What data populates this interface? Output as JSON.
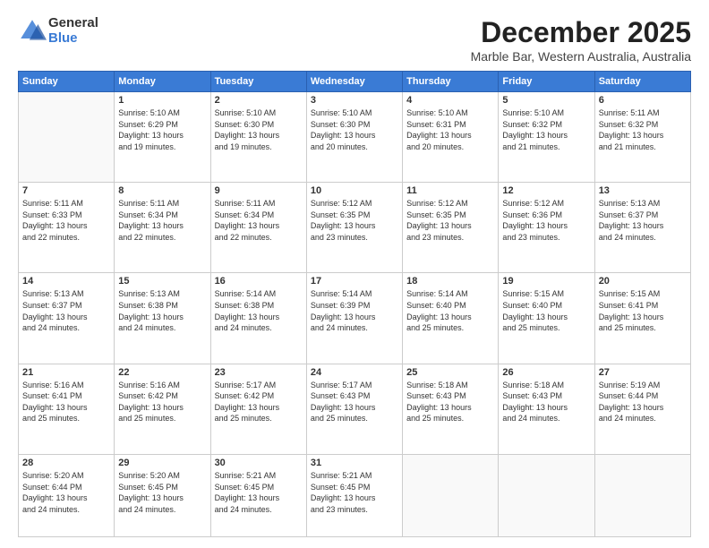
{
  "logo": {
    "general": "General",
    "blue": "Blue"
  },
  "title": "December 2025",
  "subtitle": "Marble Bar, Western Australia, Australia",
  "days_of_week": [
    "Sunday",
    "Monday",
    "Tuesday",
    "Wednesday",
    "Thursday",
    "Friday",
    "Saturday"
  ],
  "weeks": [
    [
      {
        "day": "",
        "info": ""
      },
      {
        "day": "1",
        "info": "Sunrise: 5:10 AM\nSunset: 6:29 PM\nDaylight: 13 hours\nand 19 minutes."
      },
      {
        "day": "2",
        "info": "Sunrise: 5:10 AM\nSunset: 6:30 PM\nDaylight: 13 hours\nand 19 minutes."
      },
      {
        "day": "3",
        "info": "Sunrise: 5:10 AM\nSunset: 6:30 PM\nDaylight: 13 hours\nand 20 minutes."
      },
      {
        "day": "4",
        "info": "Sunrise: 5:10 AM\nSunset: 6:31 PM\nDaylight: 13 hours\nand 20 minutes."
      },
      {
        "day": "5",
        "info": "Sunrise: 5:10 AM\nSunset: 6:32 PM\nDaylight: 13 hours\nand 21 minutes."
      },
      {
        "day": "6",
        "info": "Sunrise: 5:11 AM\nSunset: 6:32 PM\nDaylight: 13 hours\nand 21 minutes."
      }
    ],
    [
      {
        "day": "7",
        "info": "Sunrise: 5:11 AM\nSunset: 6:33 PM\nDaylight: 13 hours\nand 22 minutes."
      },
      {
        "day": "8",
        "info": "Sunrise: 5:11 AM\nSunset: 6:34 PM\nDaylight: 13 hours\nand 22 minutes."
      },
      {
        "day": "9",
        "info": "Sunrise: 5:11 AM\nSunset: 6:34 PM\nDaylight: 13 hours\nand 22 minutes."
      },
      {
        "day": "10",
        "info": "Sunrise: 5:12 AM\nSunset: 6:35 PM\nDaylight: 13 hours\nand 23 minutes."
      },
      {
        "day": "11",
        "info": "Sunrise: 5:12 AM\nSunset: 6:35 PM\nDaylight: 13 hours\nand 23 minutes."
      },
      {
        "day": "12",
        "info": "Sunrise: 5:12 AM\nSunset: 6:36 PM\nDaylight: 13 hours\nand 23 minutes."
      },
      {
        "day": "13",
        "info": "Sunrise: 5:13 AM\nSunset: 6:37 PM\nDaylight: 13 hours\nand 24 minutes."
      }
    ],
    [
      {
        "day": "14",
        "info": "Sunrise: 5:13 AM\nSunset: 6:37 PM\nDaylight: 13 hours\nand 24 minutes."
      },
      {
        "day": "15",
        "info": "Sunrise: 5:13 AM\nSunset: 6:38 PM\nDaylight: 13 hours\nand 24 minutes."
      },
      {
        "day": "16",
        "info": "Sunrise: 5:14 AM\nSunset: 6:38 PM\nDaylight: 13 hours\nand 24 minutes."
      },
      {
        "day": "17",
        "info": "Sunrise: 5:14 AM\nSunset: 6:39 PM\nDaylight: 13 hours\nand 24 minutes."
      },
      {
        "day": "18",
        "info": "Sunrise: 5:14 AM\nSunset: 6:40 PM\nDaylight: 13 hours\nand 25 minutes."
      },
      {
        "day": "19",
        "info": "Sunrise: 5:15 AM\nSunset: 6:40 PM\nDaylight: 13 hours\nand 25 minutes."
      },
      {
        "day": "20",
        "info": "Sunrise: 5:15 AM\nSunset: 6:41 PM\nDaylight: 13 hours\nand 25 minutes."
      }
    ],
    [
      {
        "day": "21",
        "info": "Sunrise: 5:16 AM\nSunset: 6:41 PM\nDaylight: 13 hours\nand 25 minutes."
      },
      {
        "day": "22",
        "info": "Sunrise: 5:16 AM\nSunset: 6:42 PM\nDaylight: 13 hours\nand 25 minutes."
      },
      {
        "day": "23",
        "info": "Sunrise: 5:17 AM\nSunset: 6:42 PM\nDaylight: 13 hours\nand 25 minutes."
      },
      {
        "day": "24",
        "info": "Sunrise: 5:17 AM\nSunset: 6:43 PM\nDaylight: 13 hours\nand 25 minutes."
      },
      {
        "day": "25",
        "info": "Sunrise: 5:18 AM\nSunset: 6:43 PM\nDaylight: 13 hours\nand 25 minutes."
      },
      {
        "day": "26",
        "info": "Sunrise: 5:18 AM\nSunset: 6:43 PM\nDaylight: 13 hours\nand 24 minutes."
      },
      {
        "day": "27",
        "info": "Sunrise: 5:19 AM\nSunset: 6:44 PM\nDaylight: 13 hours\nand 24 minutes."
      }
    ],
    [
      {
        "day": "28",
        "info": "Sunrise: 5:20 AM\nSunset: 6:44 PM\nDaylight: 13 hours\nand 24 minutes."
      },
      {
        "day": "29",
        "info": "Sunrise: 5:20 AM\nSunset: 6:45 PM\nDaylight: 13 hours\nand 24 minutes."
      },
      {
        "day": "30",
        "info": "Sunrise: 5:21 AM\nSunset: 6:45 PM\nDaylight: 13 hours\nand 24 minutes."
      },
      {
        "day": "31",
        "info": "Sunrise: 5:21 AM\nSunset: 6:45 PM\nDaylight: 13 hours\nand 23 minutes."
      },
      {
        "day": "",
        "info": ""
      },
      {
        "day": "",
        "info": ""
      },
      {
        "day": "",
        "info": ""
      }
    ]
  ]
}
